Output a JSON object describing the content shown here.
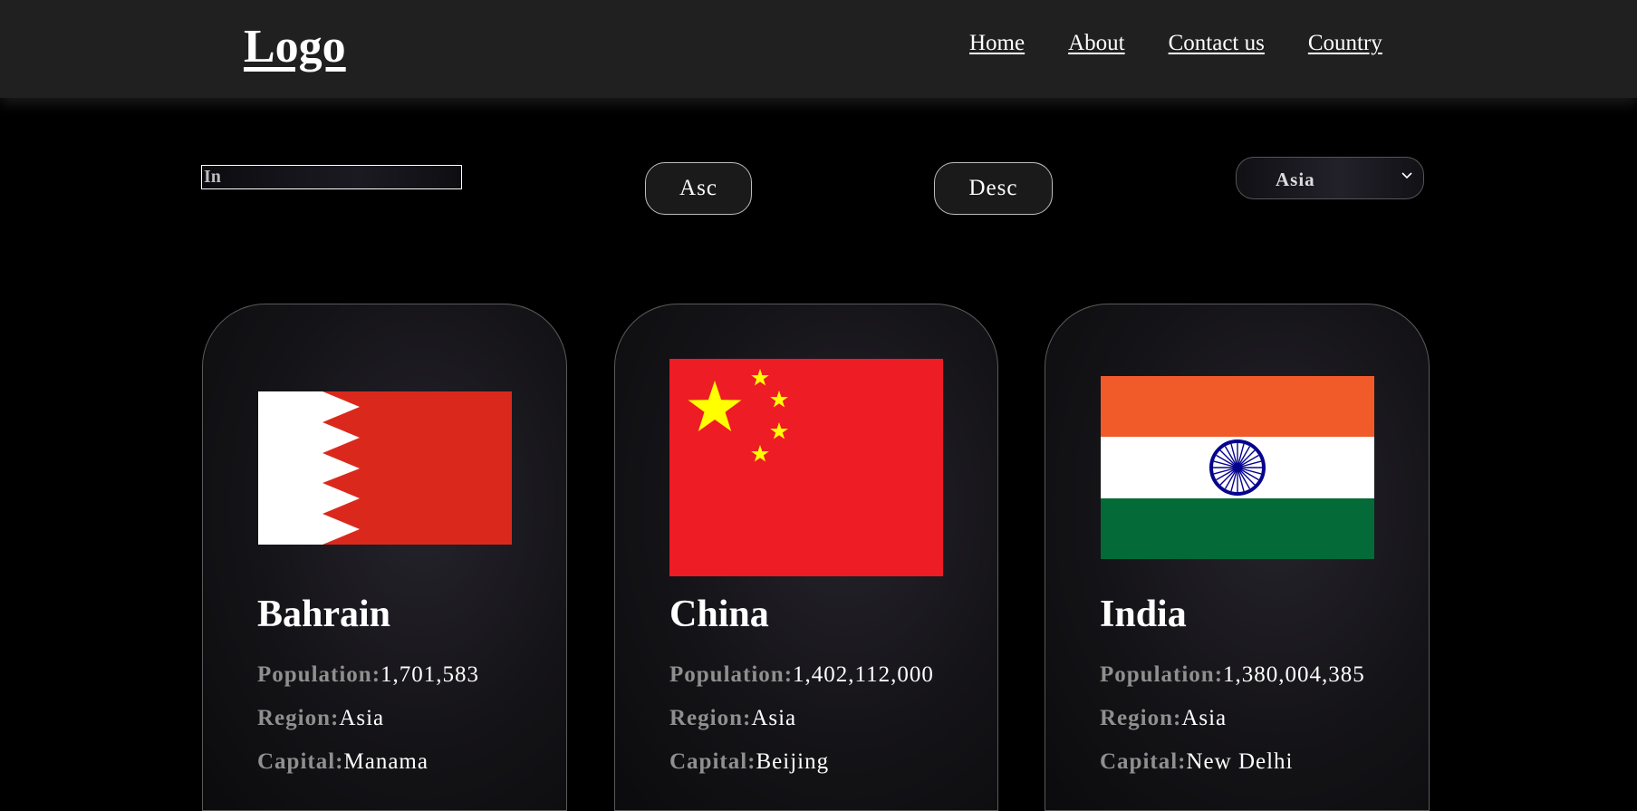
{
  "header": {
    "logo": "Logo",
    "nav": [
      "Home",
      "About",
      "Contact us",
      "Country"
    ]
  },
  "controls": {
    "search_value": "In",
    "asc_label": "Asc",
    "desc_label": "Desc",
    "region_selected": "Asia"
  },
  "labels": {
    "population": "Population:",
    "region": "Region:",
    "capital": "Capital:"
  },
  "countries": [
    {
      "name": "Bahrain",
      "population": "1,701,583",
      "region": "Asia",
      "capital": "Manama",
      "flag": "bahrain-flag"
    },
    {
      "name": "China",
      "population": "1,402,112,000",
      "region": "Asia",
      "capital": "Beijing",
      "flag": "china-flag"
    },
    {
      "name": "India",
      "population": "1,380,004,385",
      "region": "Asia",
      "capital": "New Delhi",
      "flag": "india-flag"
    }
  ],
  "colors": {
    "background": "#000000",
    "navbar": "#202020",
    "bahrain_red": "#da291c",
    "china_red": "#ee1c25",
    "china_star": "#ffff00",
    "india_saffron": "#f15a29",
    "india_green": "#046a38",
    "india_chakra": "#06038d",
    "label_gray": "#8f8f8f"
  }
}
